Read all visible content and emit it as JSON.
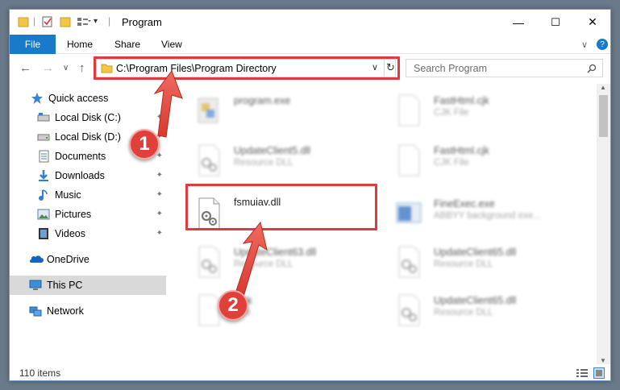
{
  "window": {
    "title": "Program",
    "minimize": "—",
    "maximize": "☐",
    "close": "✕"
  },
  "ribbon": {
    "tabs": [
      "File",
      "Home",
      "Share",
      "View"
    ],
    "help": "?"
  },
  "address": {
    "path": "C:\\Program Files\\Program Directory"
  },
  "search": {
    "placeholder": "Search Program"
  },
  "nav": {
    "items": [
      {
        "label": "Quick access",
        "icon": "star-icon"
      },
      {
        "label": "Local Disk (C:)",
        "icon": "drive-icon"
      },
      {
        "label": "Local Disk (D:)",
        "icon": "drive-icon"
      },
      {
        "label": "Documents",
        "icon": "documents-icon"
      },
      {
        "label": "Downloads",
        "icon": "download-icon"
      },
      {
        "label": "Music",
        "icon": "music-icon"
      },
      {
        "label": "Pictures",
        "icon": "pictures-icon"
      },
      {
        "label": "Videos",
        "icon": "videos-icon"
      },
      {
        "label": "OneDrive",
        "icon": "cloud-icon"
      },
      {
        "label": "This PC",
        "icon": "computer-icon"
      },
      {
        "label": "Network",
        "icon": "network-icon"
      }
    ]
  },
  "files": [
    {
      "name": "program.exe",
      "desc": ""
    },
    {
      "name": "FastHtml.cjk",
      "desc": "CJK File"
    },
    {
      "name": "UpdateClient5.dll",
      "desc": "Resource DLL"
    },
    {
      "name": "FastHtml.cjk",
      "desc": "CJK File"
    },
    {
      "name": "fsmuiav.dll",
      "desc": ""
    },
    {
      "name": "FineExec.exe",
      "desc": "ABBYY background exe..."
    },
    {
      "name": "UpdateClient63.dll",
      "desc": "Resource DLL"
    },
    {
      "name": "UpdateClient65.dll",
      "desc": "Resource DLL"
    },
    {
      "name": "...ck",
      "desc": "...ile"
    },
    {
      "name": "UpdateClient65.dll",
      "desc": "Resource DLL"
    }
  ],
  "status": {
    "count": "110 items"
  },
  "annotations": {
    "step1": "1",
    "step2": "2",
    "color": "#e03b3b"
  }
}
